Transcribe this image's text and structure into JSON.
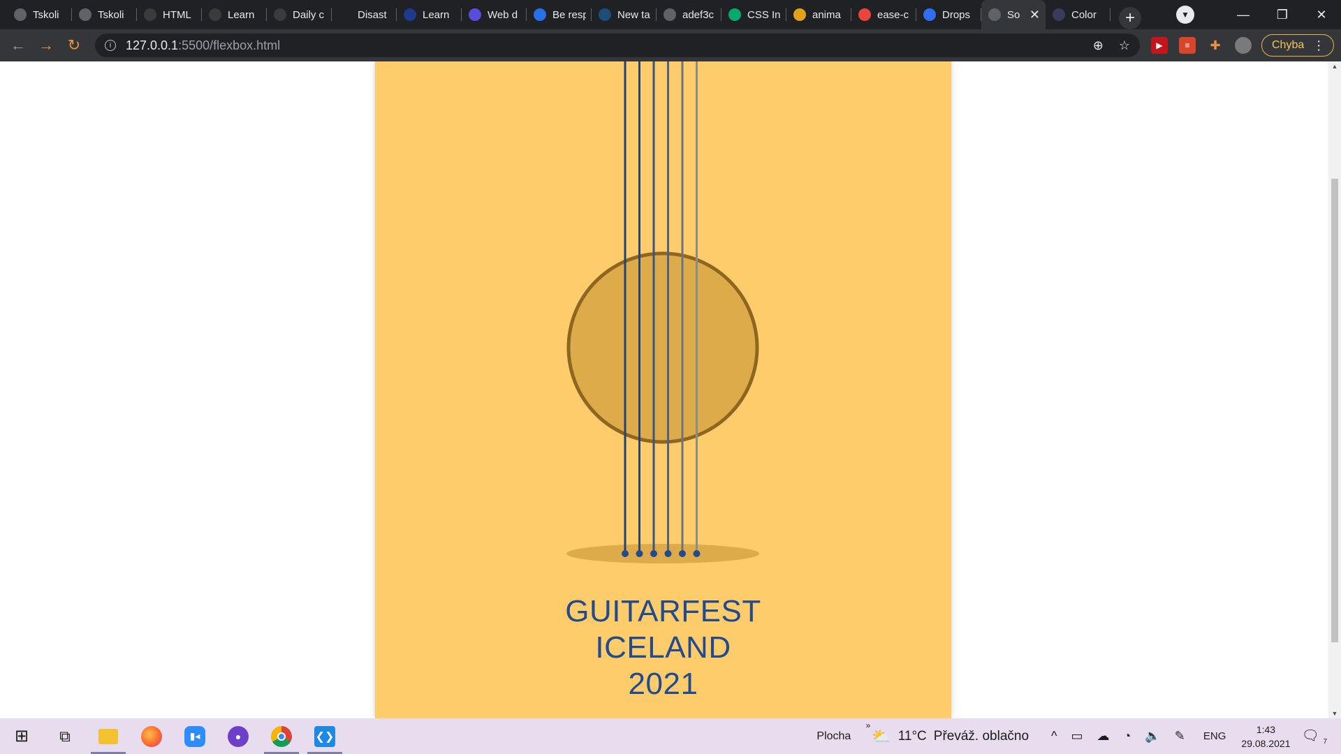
{
  "browser": {
    "tabs": [
      {
        "title": "Tskoli",
        "icon": "globe-icon",
        "color": "#5f6368"
      },
      {
        "title": "Tskoli",
        "icon": "globe-icon",
        "color": "#5f6368"
      },
      {
        "title": "HTML",
        "icon": "stairs-icon",
        "color": "#3b3b3b"
      },
      {
        "title": "Learn",
        "icon": "stairs-icon",
        "color": "#3b3b3b"
      },
      {
        "title": "Daily c",
        "icon": "stairs-icon",
        "color": "#3b3b3b"
      },
      {
        "title": "Disast",
        "icon": "star-icon",
        "color": "#202124"
      },
      {
        "title": "Learn",
        "icon": "c-logo-icon",
        "color": "#1e3a8a"
      },
      {
        "title": "Web d",
        "icon": "w-logo-icon",
        "color": "#5b4ce0"
      },
      {
        "title": "Be resp",
        "icon": "diamond-icon",
        "color": "#2a6fe8"
      },
      {
        "title": "New ta",
        "icon": "freecodecamp-icon",
        "color": "#1d4e7a"
      },
      {
        "title": "adef3c",
        "icon": "globe-icon",
        "color": "#5f6368"
      },
      {
        "title": "CSS In",
        "icon": "w3-icon",
        "color": "#04aa6d"
      },
      {
        "title": "anima",
        "icon": "chrome-icon",
        "color": "#e0a11b"
      },
      {
        "title": "ease-c",
        "icon": "asterisk-icon",
        "color": "#e8453c"
      },
      {
        "title": "Drops",
        "icon": "drop-icon",
        "color": "#2f6ff0"
      },
      {
        "title": "So",
        "icon": "globe-icon",
        "color": "#5f6368",
        "active": true
      },
      {
        "title": "Color",
        "icon": "color-icon",
        "color": "#3a3a5a"
      }
    ],
    "new_tab_label": "+",
    "address": {
      "host": "127.0.0.1",
      "path": ":5500/flexbox.html"
    },
    "profile_label": "Chyba"
  },
  "poster": {
    "background": "#fecc6a",
    "title_lines": [
      "GUITARFEST",
      "ICELAND",
      "2021"
    ],
    "title_color": "#234a8d",
    "sound_hole_fill": "#ddab49",
    "sound_hole_stroke": "#8e6620",
    "bridge_fill": "#ddab49",
    "string_colors": [
      "#1f4378",
      "#26467a",
      "#3a5580",
      "#4f6283",
      "#6a7484",
      "#8a8c8a"
    ]
  },
  "taskbar": {
    "apps": [
      {
        "name": "windows-start-icon"
      },
      {
        "name": "task-view-icon"
      },
      {
        "name": "file-explorer-icon",
        "active": true
      },
      {
        "name": "firefox-icon"
      },
      {
        "name": "zoom-icon"
      },
      {
        "name": "github-desktop-icon"
      },
      {
        "name": "chrome-icon",
        "active": true
      },
      {
        "name": "vscode-icon",
        "active": true
      }
    ],
    "desktop_label": "Plocha",
    "temperature": "11°C",
    "weather": "Převáž. oblačno",
    "language": "ENG",
    "time": "1:43",
    "date": "29.08.2021",
    "notifications": "7"
  }
}
